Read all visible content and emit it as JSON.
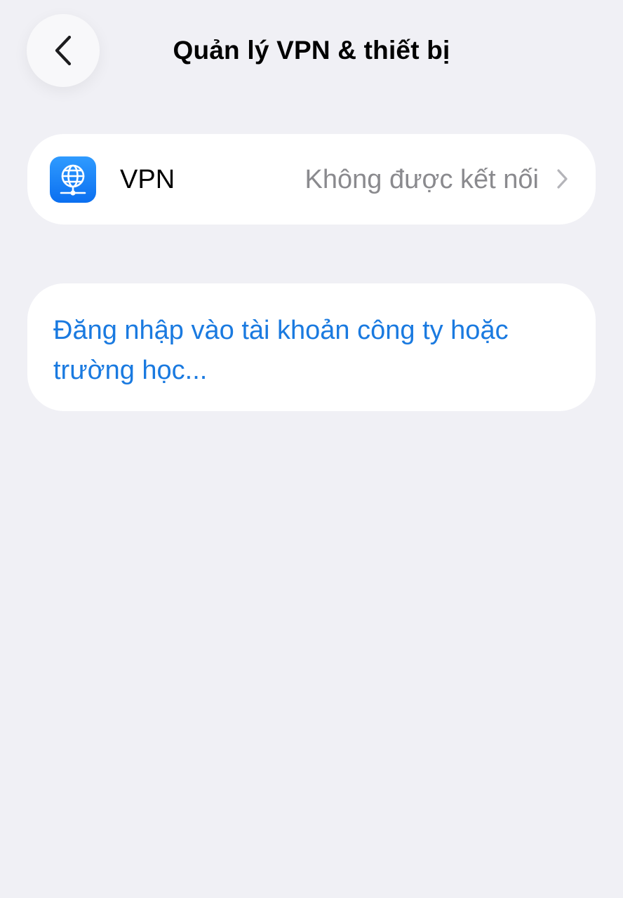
{
  "header": {
    "title": "Quản lý VPN & thiết bị",
    "back_icon": "chevron-left-icon"
  },
  "vpn_row": {
    "label": "VPN",
    "status": "Không được kết nối",
    "app_icon": "vpn-globe-icon",
    "icon_color": "#1a84f7",
    "chevron_icon": "chevron-right-icon"
  },
  "login": {
    "link_text": "Đăng nhập vào tài khoản công ty hoặc trường học..."
  },
  "colors": {
    "background": "#f0f0f5",
    "card": "#ffffff",
    "link": "#1a7ae0",
    "secondary_text": "#8a8a8e"
  }
}
